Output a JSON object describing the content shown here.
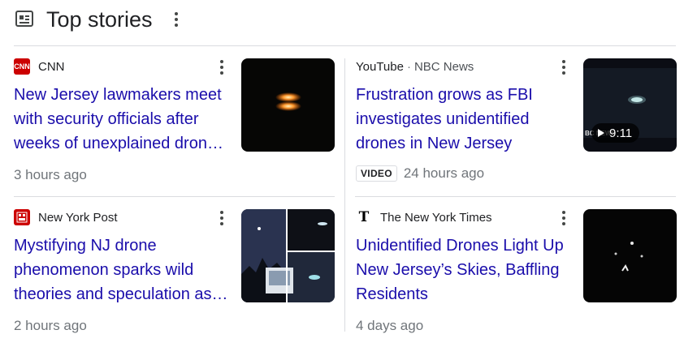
{
  "header": {
    "title": "Top stories",
    "icon": "newspaper-icon"
  },
  "stories": [
    {
      "source": "CNN",
      "source_sub": "",
      "favicon_text": "CNN",
      "favicon_color": "#cc0000",
      "headline": "New Jersey lawmakers meet with security officials after weeks of unexplained drones in the skies",
      "time": "3 hours ago",
      "badge": "",
      "duration": ""
    },
    {
      "source": "YouTube",
      "source_sub": "NBC News",
      "favicon_text": "",
      "favicon_color": "",
      "headline": "Frustration grows as FBI investigates unidentified drones in New Jersey",
      "time": "24 hours ago",
      "badge": "VIDEO",
      "duration": "9:11",
      "thumb_overlay": "BC NEWS"
    },
    {
      "source": "New York Post",
      "source_sub": "",
      "favicon_text": "",
      "favicon_color": "#cc0000",
      "headline": "Mystifying NJ drone phenomenon sparks wild theories and speculation as officials remain baffled",
      "time": "2 hours ago",
      "badge": "",
      "duration": ""
    },
    {
      "source": "The New York Times",
      "source_sub": "",
      "favicon_text": "T",
      "favicon_color": "#000000",
      "headline": "Unidentified Drones Light Up New Jersey’s Skies, Baffling Residents",
      "time": "4 days ago",
      "badge": "",
      "duration": ""
    }
  ],
  "colors": {
    "link": "#1a0dab",
    "meta": "#70757a",
    "divider": "#dadce0"
  }
}
